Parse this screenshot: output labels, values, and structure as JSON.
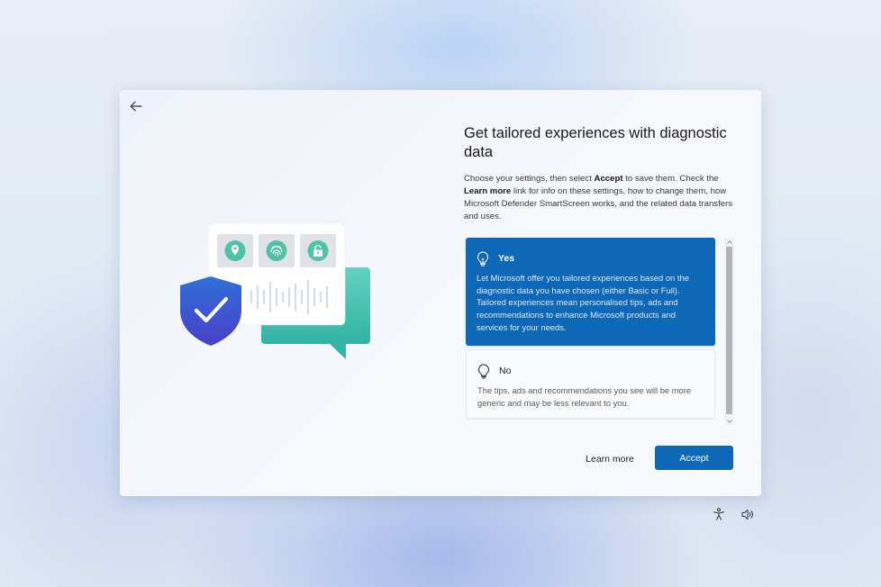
{
  "dialog": {
    "title": "Get tailored experiences with diagnostic data",
    "description": {
      "p1": "Choose your settings, then select ",
      "accept_word": "Accept",
      "p2": " to save them. Check the ",
      "learn_word": "Learn more",
      "p3": " link for info on these settings, how to change them, how Microsoft Defender SmartScreen works, and the related data transfers and uses."
    },
    "options": [
      {
        "label": "Yes",
        "text": "Let Microsoft offer you tailored experiences based on the diagnostic data you have chosen (either Basic or Full). Tailored experiences mean personalised tips, ads and recommendations to enhance Microsoft products and services for your needs.",
        "selected": true,
        "icon": "lightbulb-icon"
      },
      {
        "label": "No",
        "text": "The tips, ads and recommendations you see will be more generic and may be less relevant to you.",
        "selected": false,
        "icon": "lightbulb-icon"
      }
    ],
    "buttons": {
      "learn_more": "Learn more",
      "accept": "Accept"
    }
  },
  "colors": {
    "accent": "#0f67b8",
    "shield": "#3d55d4",
    "chat_bubble": "#3cc0ae",
    "tile_teal": "#4fc2a8"
  },
  "icons": {
    "back": "back-arrow-icon",
    "tray": [
      "accessibility-icon",
      "volume-icon"
    ]
  }
}
